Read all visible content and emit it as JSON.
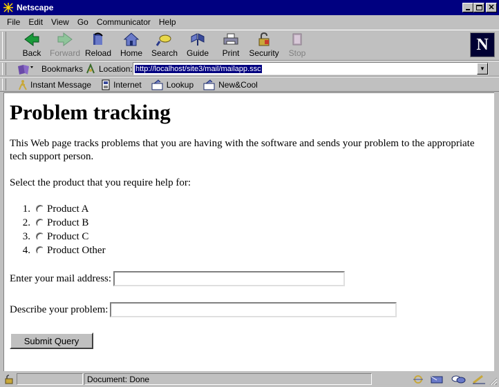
{
  "window": {
    "title": "Netscape"
  },
  "menu": [
    "File",
    "Edit",
    "View",
    "Go",
    "Communicator",
    "Help"
  ],
  "nav_buttons": [
    {
      "label": "Back",
      "icon": "back-arrow-icon",
      "enabled": true
    },
    {
      "label": "Forward",
      "icon": "forward-arrow-icon",
      "enabled": false
    },
    {
      "label": "Reload",
      "icon": "reload-icon",
      "enabled": true
    },
    {
      "label": "Home",
      "icon": "home-icon",
      "enabled": true
    },
    {
      "label": "Search",
      "icon": "search-icon",
      "enabled": true
    },
    {
      "label": "Guide",
      "icon": "guide-icon",
      "enabled": true
    },
    {
      "label": "Print",
      "icon": "print-icon",
      "enabled": true
    },
    {
      "label": "Security",
      "icon": "lock-icon",
      "enabled": true
    },
    {
      "label": "Stop",
      "icon": "stop-icon",
      "enabled": false
    }
  ],
  "location_bar": {
    "bookmarks_label": "Bookmarks",
    "location_label": "Location:",
    "url": "http://localhost/site3/mail/mailapp.ssc"
  },
  "personal_toolbar": [
    "Instant Message",
    "Internet",
    "Lookup",
    "New&Cool"
  ],
  "page": {
    "heading": "Problem tracking",
    "intro": "This Web page tracks problems that you are having with the software and sends your problem to the appropriate tech support person.",
    "select_prompt": "Select the product that you require help for:",
    "products": [
      {
        "num": "1.",
        "label": "Product A"
      },
      {
        "num": "2.",
        "label": "Product B"
      },
      {
        "num": "3.",
        "label": "Product C"
      },
      {
        "num": "4.",
        "label": "Product Other"
      }
    ],
    "email_label": "Enter your mail address:",
    "email_value": "",
    "problem_label": "Describe your problem:",
    "problem_value": "",
    "submit_label": "Submit Query"
  },
  "status": {
    "text": "Document: Done"
  },
  "colors": {
    "titlebar": "#000080",
    "chrome": "#c0c0c0",
    "selection": "#000080"
  }
}
